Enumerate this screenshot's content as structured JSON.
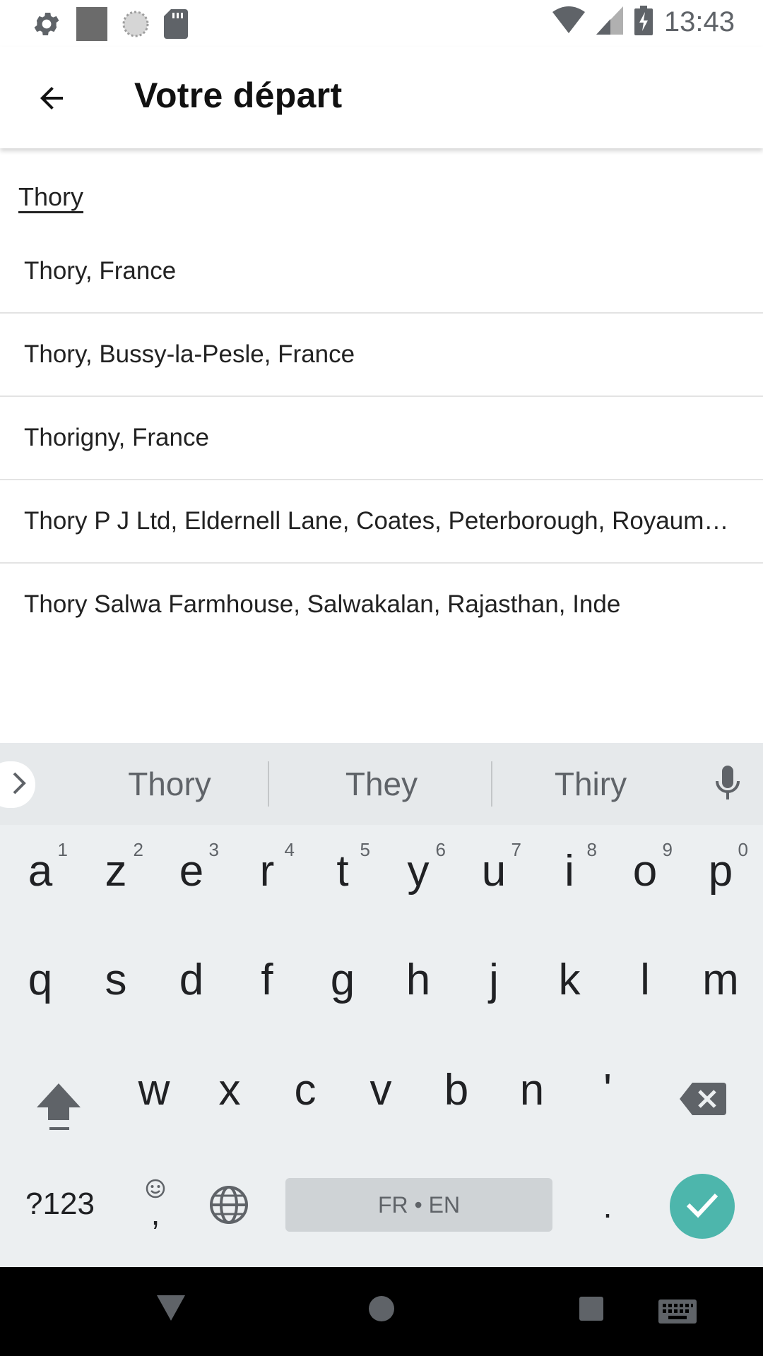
{
  "status_bar": {
    "time": "13:43",
    "icons_left": [
      "gear-icon",
      "image-icon",
      "sync-icon",
      "sdcard-icon"
    ],
    "icons_right": [
      "wifi-icon",
      "signal-icon",
      "battery-charging-icon"
    ]
  },
  "app_bar": {
    "title": "Votre départ",
    "back_icon": "arrow-back-icon"
  },
  "search": {
    "value": "Thory"
  },
  "suggestions": [
    "Thory, France",
    "Thory, Bussy-la-Pesle, France",
    "Thorigny, France",
    "Thory P J Ltd, Eldernell Lane, Coates, Peterborough, Royaume-Uni",
    "Thory Salwa Farmhouse, Salwakalan, Rajasthan, Inde"
  ],
  "keyboard": {
    "word_suggestions": [
      "Thory",
      "They",
      "Thiry"
    ],
    "row1": [
      {
        "k": "a",
        "n": "1"
      },
      {
        "k": "z",
        "n": "2"
      },
      {
        "k": "e",
        "n": "3"
      },
      {
        "k": "r",
        "n": "4"
      },
      {
        "k": "t",
        "n": "5"
      },
      {
        "k": "y",
        "n": "6"
      },
      {
        "k": "u",
        "n": "7"
      },
      {
        "k": "i",
        "n": "8"
      },
      {
        "k": "o",
        "n": "9"
      },
      {
        "k": "p",
        "n": "0"
      }
    ],
    "row2": [
      "q",
      "s",
      "d",
      "f",
      "g",
      "h",
      "j",
      "k",
      "l",
      "m"
    ],
    "row3": [
      "w",
      "x",
      "c",
      "v",
      "b",
      "n",
      "'"
    ],
    "symbols_label": "?123",
    "comma_label": ",",
    "space_label": "FR • EN",
    "period_label": ".",
    "accent_color": "#4db6ac"
  },
  "nav_bar": {
    "icons": [
      "back-triangle-icon",
      "home-circle-icon",
      "recents-square-icon",
      "keyboard-icon"
    ]
  }
}
